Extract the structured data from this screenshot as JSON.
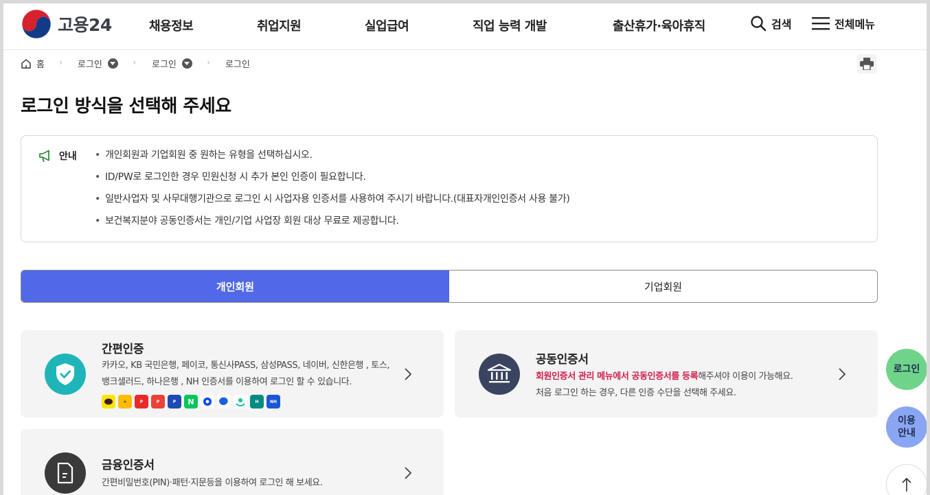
{
  "header": {
    "logo_text": "고용24",
    "nav": [
      "채용정보",
      "취업지원",
      "실업급여",
      "직업 능력 개발",
      "출산휴가·육아휴직"
    ],
    "search_label": "검색",
    "menu_label": "전체메뉴"
  },
  "breadcrumb": {
    "home": "홈",
    "level1": "로그인",
    "level2": "로그인",
    "current": "로그인"
  },
  "page_title": "로그인 방식을 선택해 주세요",
  "notice": {
    "label": "안내",
    "items": [
      "개인회원과 기업회원 중 원하는 유형을 선택하십시오.",
      "ID/PW로 로그인한 경우 민원신청 시 추가 본인 인증이 필요합니다.",
      "일반사업자 및 사무대행기관으로 로그인 시 사업자용 인증서를 사용하여 주시기 바랍니다.(대표자개인인증서 사용 불가)",
      "보건복지분야 공동인증서는 개인/기업 사업장 회원 대상 무료로 제공합니다."
    ]
  },
  "tabs": {
    "personal": "개인회원",
    "business": "기업회원",
    "active": "personal"
  },
  "cards": {
    "simple": {
      "title": "간편인증",
      "desc_line1": "카카오, KB 국민은행, 페이코, 통신사PASS, 삼성PASS, 네이버, 신한은행 , 토스,",
      "desc_line2": "뱅크샐러드, 하나은행 , NH 인증서를 이용하여 로그인 할 수 있습니다.",
      "providers": [
        "kakao-icon",
        "kb-icon",
        "payco-icon",
        "pass-icon",
        "samsung-pass-icon",
        "naver-icon",
        "shinhan-icon",
        "toss-icon",
        "banksalad-icon",
        "hana-icon",
        "nh-icon"
      ]
    },
    "joint": {
      "title": "공동인증서",
      "desc_red": "회원인증서 관리 메뉴에서 공동인증서를 등록",
      "desc_rest": "해주셔야 이용이 가능해요.",
      "desc_line2": "처음 로그인 하는 경우, 다른 인증 수단을 선택해 주세요."
    },
    "finance": {
      "title": "금융인증서",
      "desc": "간편비밀번호(PIN)·패턴·지문등을 이용하여 로그인 해 보세요."
    }
  },
  "floating": {
    "login": "로그인",
    "guide_line1": "이용",
    "guide_line2": "안내"
  },
  "colors": {
    "primary": "#5169e6",
    "shield": "#1fb5b8",
    "bank": "#3a4460",
    "highlight": "#d0204e",
    "float_login": "#6fd48a",
    "float_guide": "#8aa6f2"
  }
}
